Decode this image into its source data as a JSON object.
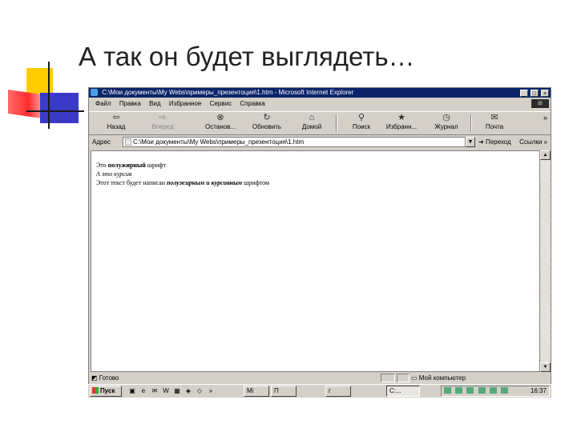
{
  "slide": {
    "title": "А так он будет выглядеть…"
  },
  "window": {
    "title": "C:\\Мои документы\\My Webs\\примеры_презентоция\\1.htm - Microsoft Internet Explorer",
    "buttons": {
      "minimize": "_",
      "maximize": "□",
      "close": "×"
    }
  },
  "menu": [
    "Файл",
    "Правка",
    "Вид",
    "Избранное",
    "Сервис",
    "Справка"
  ],
  "toolbar": {
    "back": "Назад",
    "back_icon": "⇦",
    "forward": "Вперед",
    "forward_icon": "⇨",
    "stop": "Останов...",
    "stop_icon": "⊗",
    "refresh": "Обновить",
    "refresh_icon": "↻",
    "home": "Домой",
    "home_icon": "⌂",
    "search": "Поиск",
    "search_icon": "⚲",
    "favorites": "Избранн...",
    "favorites_icon": "★",
    "history": "Журнал",
    "history_icon": "◷",
    "mail": "Почта",
    "mail_icon": "✉",
    "more": "»"
  },
  "address": {
    "label": "Адрес",
    "value": "C:\\Мои документы\\My Webs\\примеры_презентоция\\1.htm",
    "go": "Переход",
    "links": "Ссылки"
  },
  "content": {
    "line1_prefix": "Это ",
    "line1_bold": "полужирный",
    "line1_suffix": " шрифт",
    "line2_italic": "А это курсив",
    "line3_prefix": "Этот текст будет написан ",
    "line3_bolditalic": "полужирным и курсивным",
    "line3_suffix": " шрифтом"
  },
  "status": {
    "text": "Готово",
    "zone": "Мой компьютер"
  },
  "taskbar": {
    "start": "Пуск",
    "tasks": [
      "Mi",
      "П",
      "г",
      "С:..."
    ],
    "clock": "16:37"
  }
}
